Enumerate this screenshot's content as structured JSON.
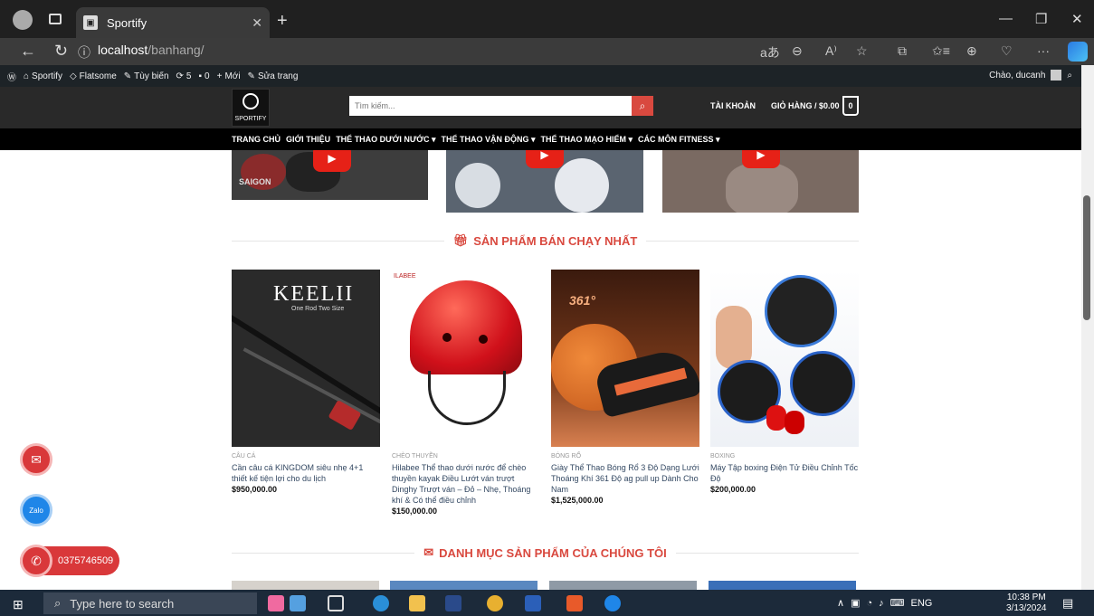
{
  "browser": {
    "tab_title": "Sportify",
    "url_host": "localhost",
    "url_path": "/banhang/",
    "address_icons": [
      "aあ",
      "⊖",
      "A⁾",
      "☆",
      "⧉",
      "✩≡",
      "⊕",
      "♡",
      "···"
    ]
  },
  "wp_admin": {
    "items": [
      "Sportify",
      "Flatsome",
      "Tùy biến",
      "5",
      "0",
      "Mới",
      "Sửa trang"
    ],
    "greeting": "Chào, ducanh"
  },
  "header": {
    "search_placeholder": "Tìm kiếm...",
    "account": "TÀI KHOẢN",
    "cart": "GIỎ HÀNG / $0.00",
    "cart_count": "0",
    "logo_text": "SPORTIFY"
  },
  "nav": [
    "TRANG CHỦ",
    "GIỚI THIỆU",
    "THỂ THAO DƯỚI NƯỚC ▾",
    "THỂ THAO VẬN ĐỘNG ▾",
    "THỂ THAO MẠO HIỂM ▾",
    "CÁC MÔN FITNESS ▾"
  ],
  "videos": {
    "thumb1_caption": "SAIGON"
  },
  "sections": {
    "bestsellers": "SẢN PHẨM BÁN CHẠY NHẤT",
    "categories": "DANH MỤC SẢN PHẨM CỦA CHÚNG TÔI"
  },
  "products": [
    {
      "category": "CÂU CÁ",
      "name": "Cần câu cá KINGDOM siêu nhẹ 4+1 thiết kế tiện lợi cho du lịch",
      "price": "$950,000.00",
      "img_title": "KEELII",
      "img_sub": "One Rod Two Size"
    },
    {
      "category": "CHÈO THUYỀN",
      "name": "Hilabee Thể thao dưới nước để chèo thuyền kayak Điều Lướt ván trượt Dinghy Trượt ván – Đỏ – Nhẹ, Thoáng khí & Có thể điều chỉnh",
      "price": "$150,000.00",
      "img_title": "ILABEE"
    },
    {
      "category": "BÓNG RỔ",
      "name": "Giày Thể Thao Bóng Rổ 3 Độ Dạng Lưới Thoáng Khí 361 Độ ag pull up Dành Cho Nam",
      "price": "$1,525,000.00",
      "img_title": "361°"
    },
    {
      "category": "BOXING",
      "name": "Máy Tập boxing Điện Tử Điều Chỉnh Tốc Độ",
      "price": "$200,000.00"
    }
  ],
  "contact": {
    "phone": "0375746509",
    "zalo_label": "Zalo"
  },
  "taskbar": {
    "search_placeholder": "Type here to search",
    "lang": "ENG",
    "time": "10:38 PM",
    "date": "3/13/2024"
  },
  "colors": {
    "accent": "#d9493f",
    "header_bg": "#222222",
    "nav_bg": "#000000",
    "link": "#334862"
  }
}
